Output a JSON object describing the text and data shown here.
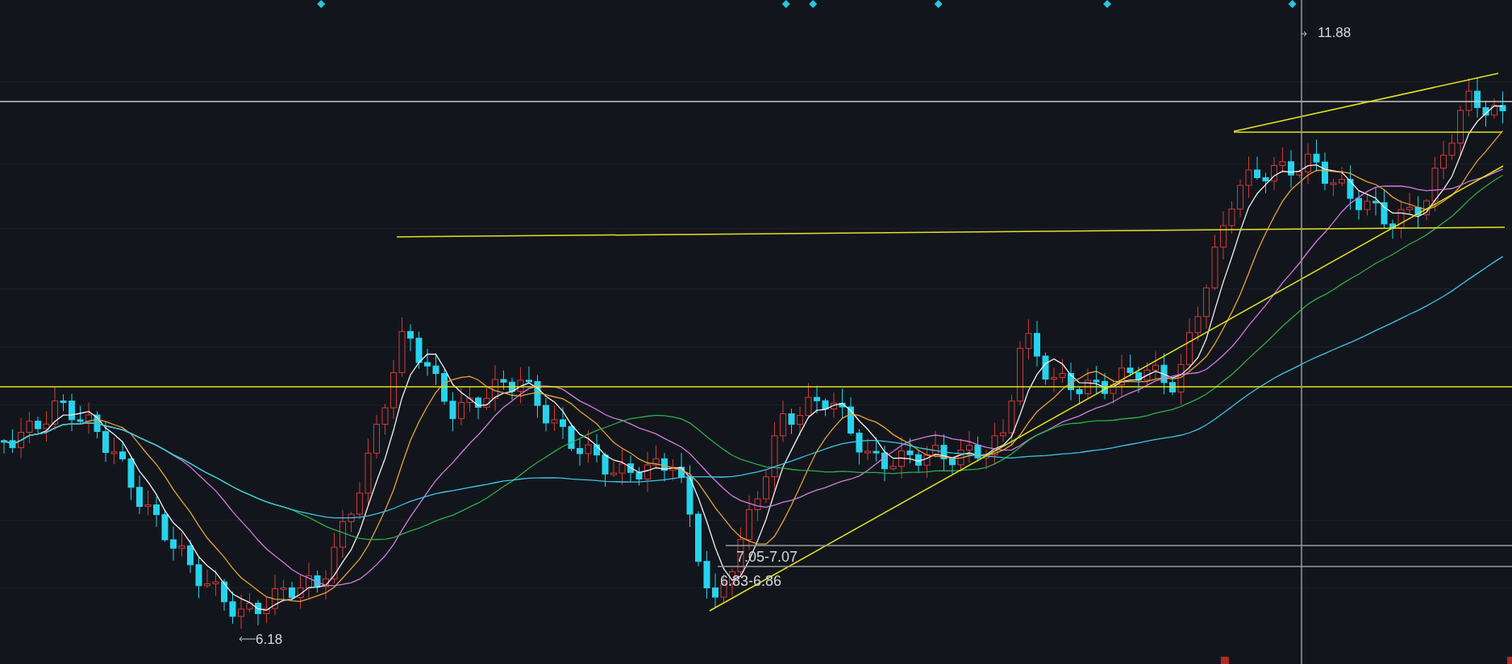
{
  "price_labels": [
    {
      "kind": "high",
      "text": "11.88"
    },
    {
      "kind": "low",
      "text": "6.18"
    }
  ],
  "range_labels": [
    {
      "text": "7.05-7.07"
    },
    {
      "text": "6.83-6.86"
    }
  ]
}
